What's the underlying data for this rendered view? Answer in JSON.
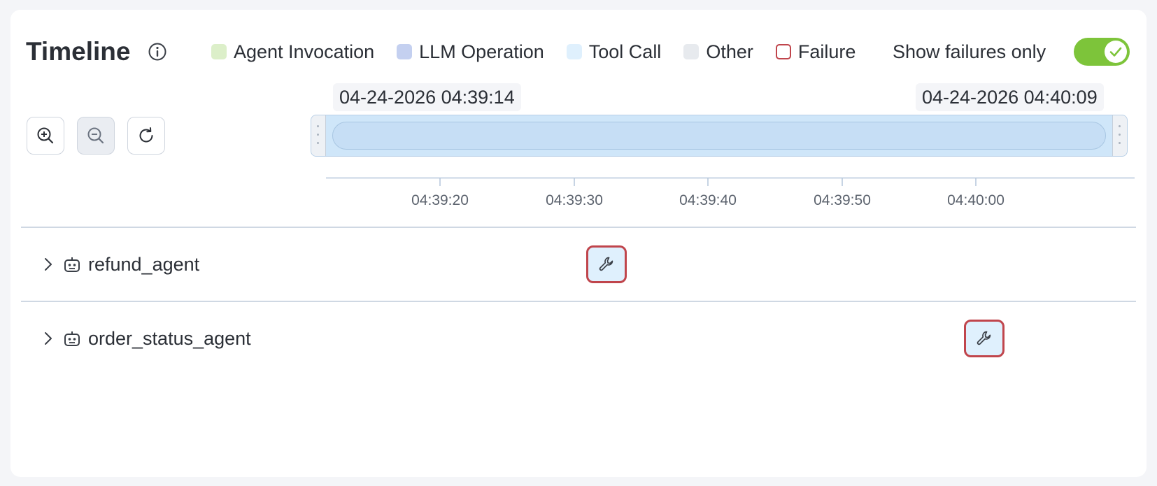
{
  "header": {
    "title": "Timeline",
    "show_failures_label": "Show failures only",
    "show_failures_on": true
  },
  "legend": [
    {
      "label": "Agent Invocation",
      "color": "#dcefc9",
      "kind": "fill"
    },
    {
      "label": "LLM Operation",
      "color": "#c4d0f0",
      "kind": "fill"
    },
    {
      "label": "Tool Call",
      "color": "#dff0fd",
      "kind": "fill"
    },
    {
      "label": "Other",
      "color": "#e7eaee",
      "kind": "fill"
    },
    {
      "label": "Failure",
      "color": "#c0454c",
      "kind": "outline"
    }
  ],
  "range": {
    "start": "04-24-2026 04:39:14",
    "end": "04-24-2026 04:40:09"
  },
  "axis": {
    "ticks": [
      "04:39:20",
      "04:39:30",
      "04:39:40",
      "04:39:50",
      "04:40:00"
    ]
  },
  "rows": [
    {
      "name": "refund_agent",
      "spans": [
        {
          "type": "tool-call",
          "status": "failure",
          "start": "04:39:32"
        }
      ]
    },
    {
      "name": "order_status_agent",
      "spans": [
        {
          "type": "tool-call",
          "status": "failure",
          "start": "04:40:00"
        }
      ]
    }
  ],
  "icons": {
    "info": "info-icon",
    "zoom_in": "zoom-in-icon",
    "zoom_out": "zoom-out-icon",
    "reset": "reset-icon",
    "expand": "chevron-right-icon",
    "agent": "robot-icon",
    "tool": "wrench-icon",
    "toggle_check": "check-icon"
  },
  "colors": {
    "toggle_on": "#7dc43a",
    "failure_border": "#c0454c",
    "tool_fill": "#dff0fd",
    "scrubber_fill": "#cfe6f9"
  }
}
